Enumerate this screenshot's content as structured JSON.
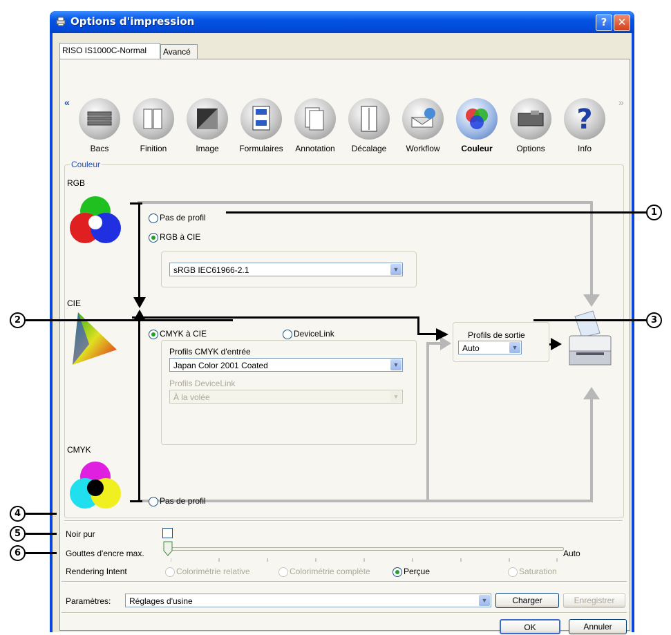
{
  "window": {
    "title": "Options d'impression",
    "help": "?",
    "close": "✕"
  },
  "tabs": [
    "RISO IS1000C-Normal",
    "Avancé"
  ],
  "toolbar": {
    "scroll_left": "«",
    "scroll_right": "»",
    "items": [
      "Bacs",
      "Finition",
      "Image",
      "Formulaires",
      "Annotation",
      "Décalage",
      "Workflow",
      "Couleur",
      "Options",
      "Info"
    ],
    "active": "Couleur"
  },
  "couleur": {
    "group_label": "Couleur",
    "rgb_label": "RGB",
    "cie_label": "CIE",
    "cmyk_label": "CMYK",
    "rgb_no_profile": "Pas de profil",
    "rgb_to_cie": "RGB à CIE",
    "rgb_profile_value": "sRGB IEC61966-2.1",
    "cmyk_to_cie": "CMYK à CIE",
    "devicelink": "DeviceLink",
    "cmyk_input_label": "Profils CMYK d'entrée",
    "cmyk_input_value": "Japan Color 2001 Coated",
    "devicelink_label": "Profils DeviceLink",
    "devicelink_value": "À la volée",
    "cmyk_no_profile": "Pas de profil",
    "output_label": "Profils de sortie",
    "output_value": "Auto"
  },
  "options": {
    "noir_pur": "Noir pur",
    "gouttes": "Gouttes d'encre max.",
    "gouttes_value": "Auto",
    "rendering": "Rendering Intent",
    "intents": [
      "Colorimétrie relative",
      "Colorimétrie complète",
      "Perçue",
      "Saturation"
    ]
  },
  "params": {
    "label": "Paramètres:",
    "value": "Réglages d'usine",
    "load": "Charger",
    "save": "Enregistrer"
  },
  "footer": {
    "ok": "OK",
    "cancel": "Annuler"
  },
  "callouts": [
    "1",
    "2",
    "3",
    "4",
    "5",
    "6"
  ]
}
